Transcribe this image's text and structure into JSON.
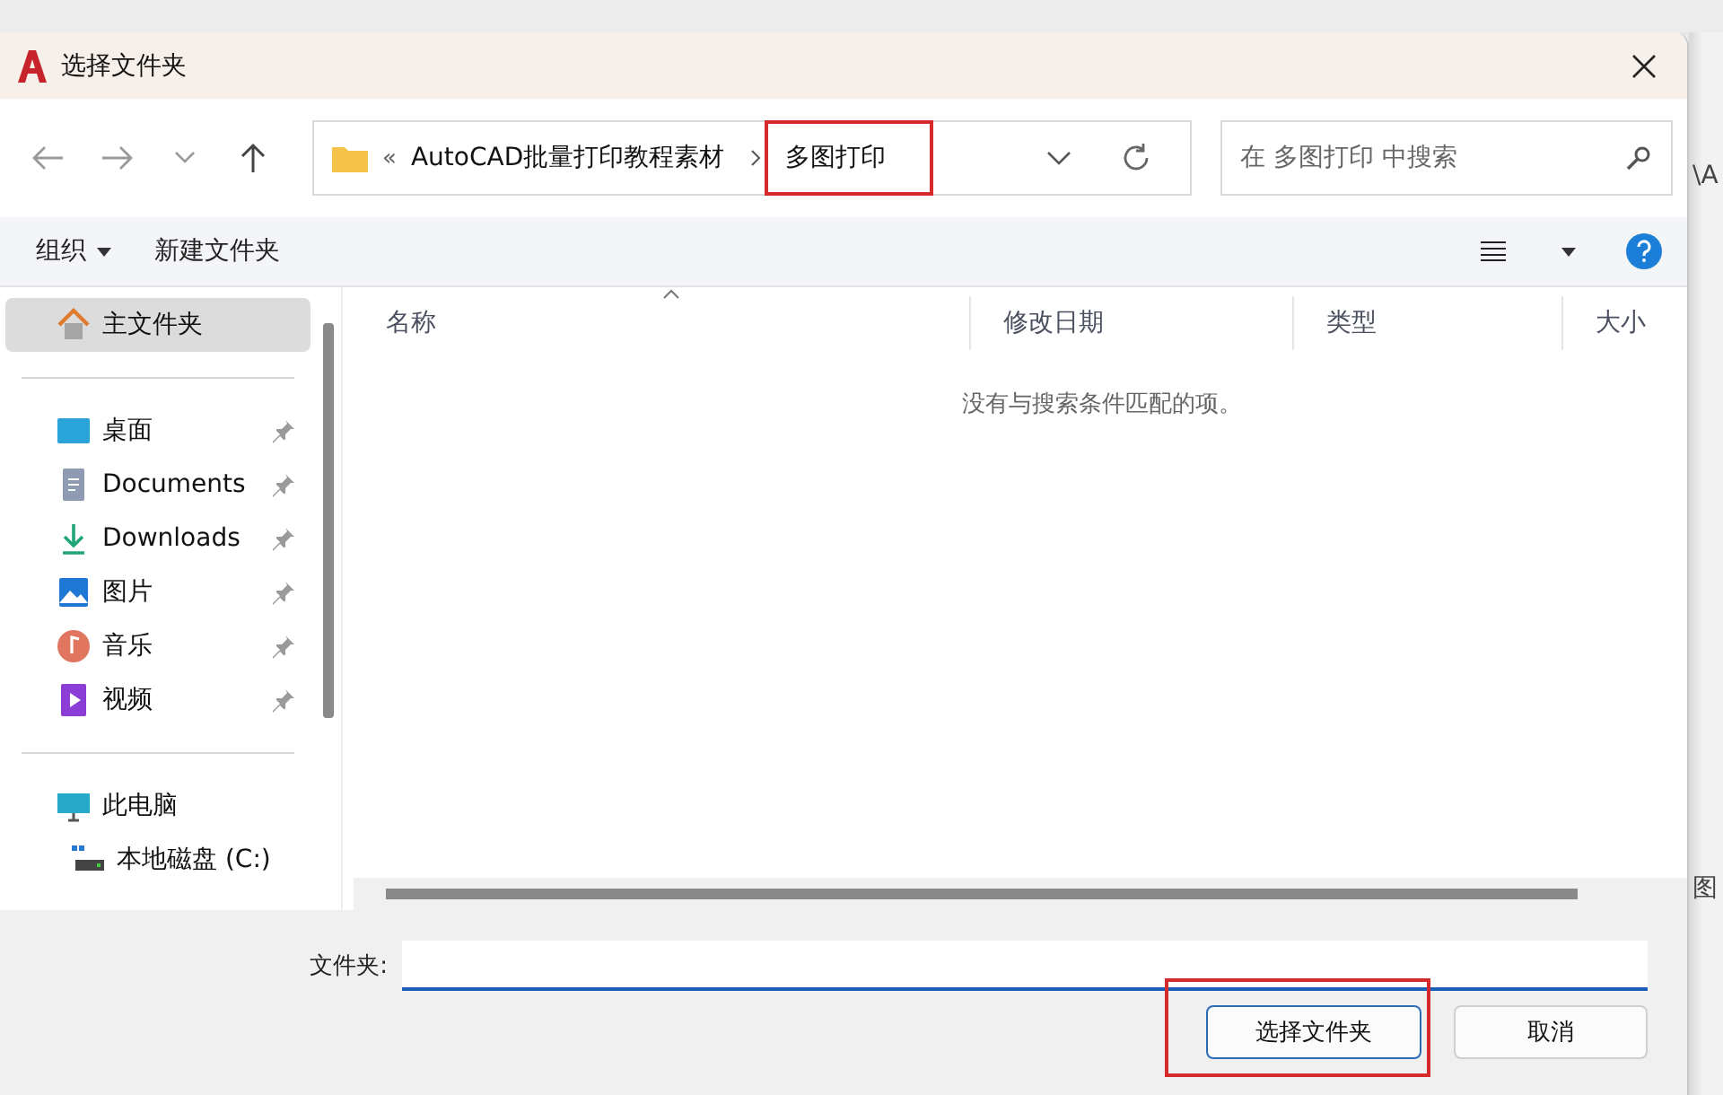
{
  "background_window": {
    "fragments": [
      "\\A",
      "图"
    ]
  },
  "dialog": {
    "title": "选择文件夹"
  },
  "address_bar": {
    "overflow": "«",
    "path": [
      {
        "label": "AutoCAD批量打印教程素材",
        "highlighted": false
      },
      {
        "label": "多图打印",
        "highlighted": true
      }
    ]
  },
  "search": {
    "placeholder": "在 多图打印 中搜索"
  },
  "toolbar": {
    "organize": "组织",
    "new_folder": "新建文件夹"
  },
  "sidebar": {
    "sections": [
      {
        "items": [
          {
            "label": "主文件夹",
            "kind": "home",
            "selected": true,
            "pinned": false
          }
        ]
      },
      {
        "items": [
          {
            "label": "桌面",
            "kind": "desktop",
            "selected": false,
            "pinned": true
          },
          {
            "label": "Documents",
            "kind": "documents",
            "selected": false,
            "pinned": true
          },
          {
            "label": "Downloads",
            "kind": "downloads",
            "selected": false,
            "pinned": true
          },
          {
            "label": "图片",
            "kind": "pictures",
            "selected": false,
            "pinned": true
          },
          {
            "label": "音乐",
            "kind": "music",
            "selected": false,
            "pinned": true
          },
          {
            "label": "视频",
            "kind": "videos",
            "selected": false,
            "pinned": true
          }
        ]
      },
      {
        "items": [
          {
            "label": "此电脑",
            "kind": "computer",
            "selected": false,
            "pinned": false,
            "children": [
              {
                "label": "本地磁盘 (C:)",
                "kind": "drive",
                "selected": false,
                "pinned": false
              }
            ]
          }
        ]
      }
    ]
  },
  "columns": [
    {
      "label": "名称",
      "sorted": true
    },
    {
      "label": "修改日期",
      "sorted": false
    },
    {
      "label": "类型",
      "sorted": false
    },
    {
      "label": "大小",
      "sorted": false
    }
  ],
  "empty_message": "没有与搜索条件匹配的项。",
  "folder_field": {
    "label": "文件夹:"
  },
  "buttons": [
    {
      "label": "选择文件夹",
      "highlighted": true
    },
    {
      "label": "取消",
      "highlighted": false
    }
  ]
}
